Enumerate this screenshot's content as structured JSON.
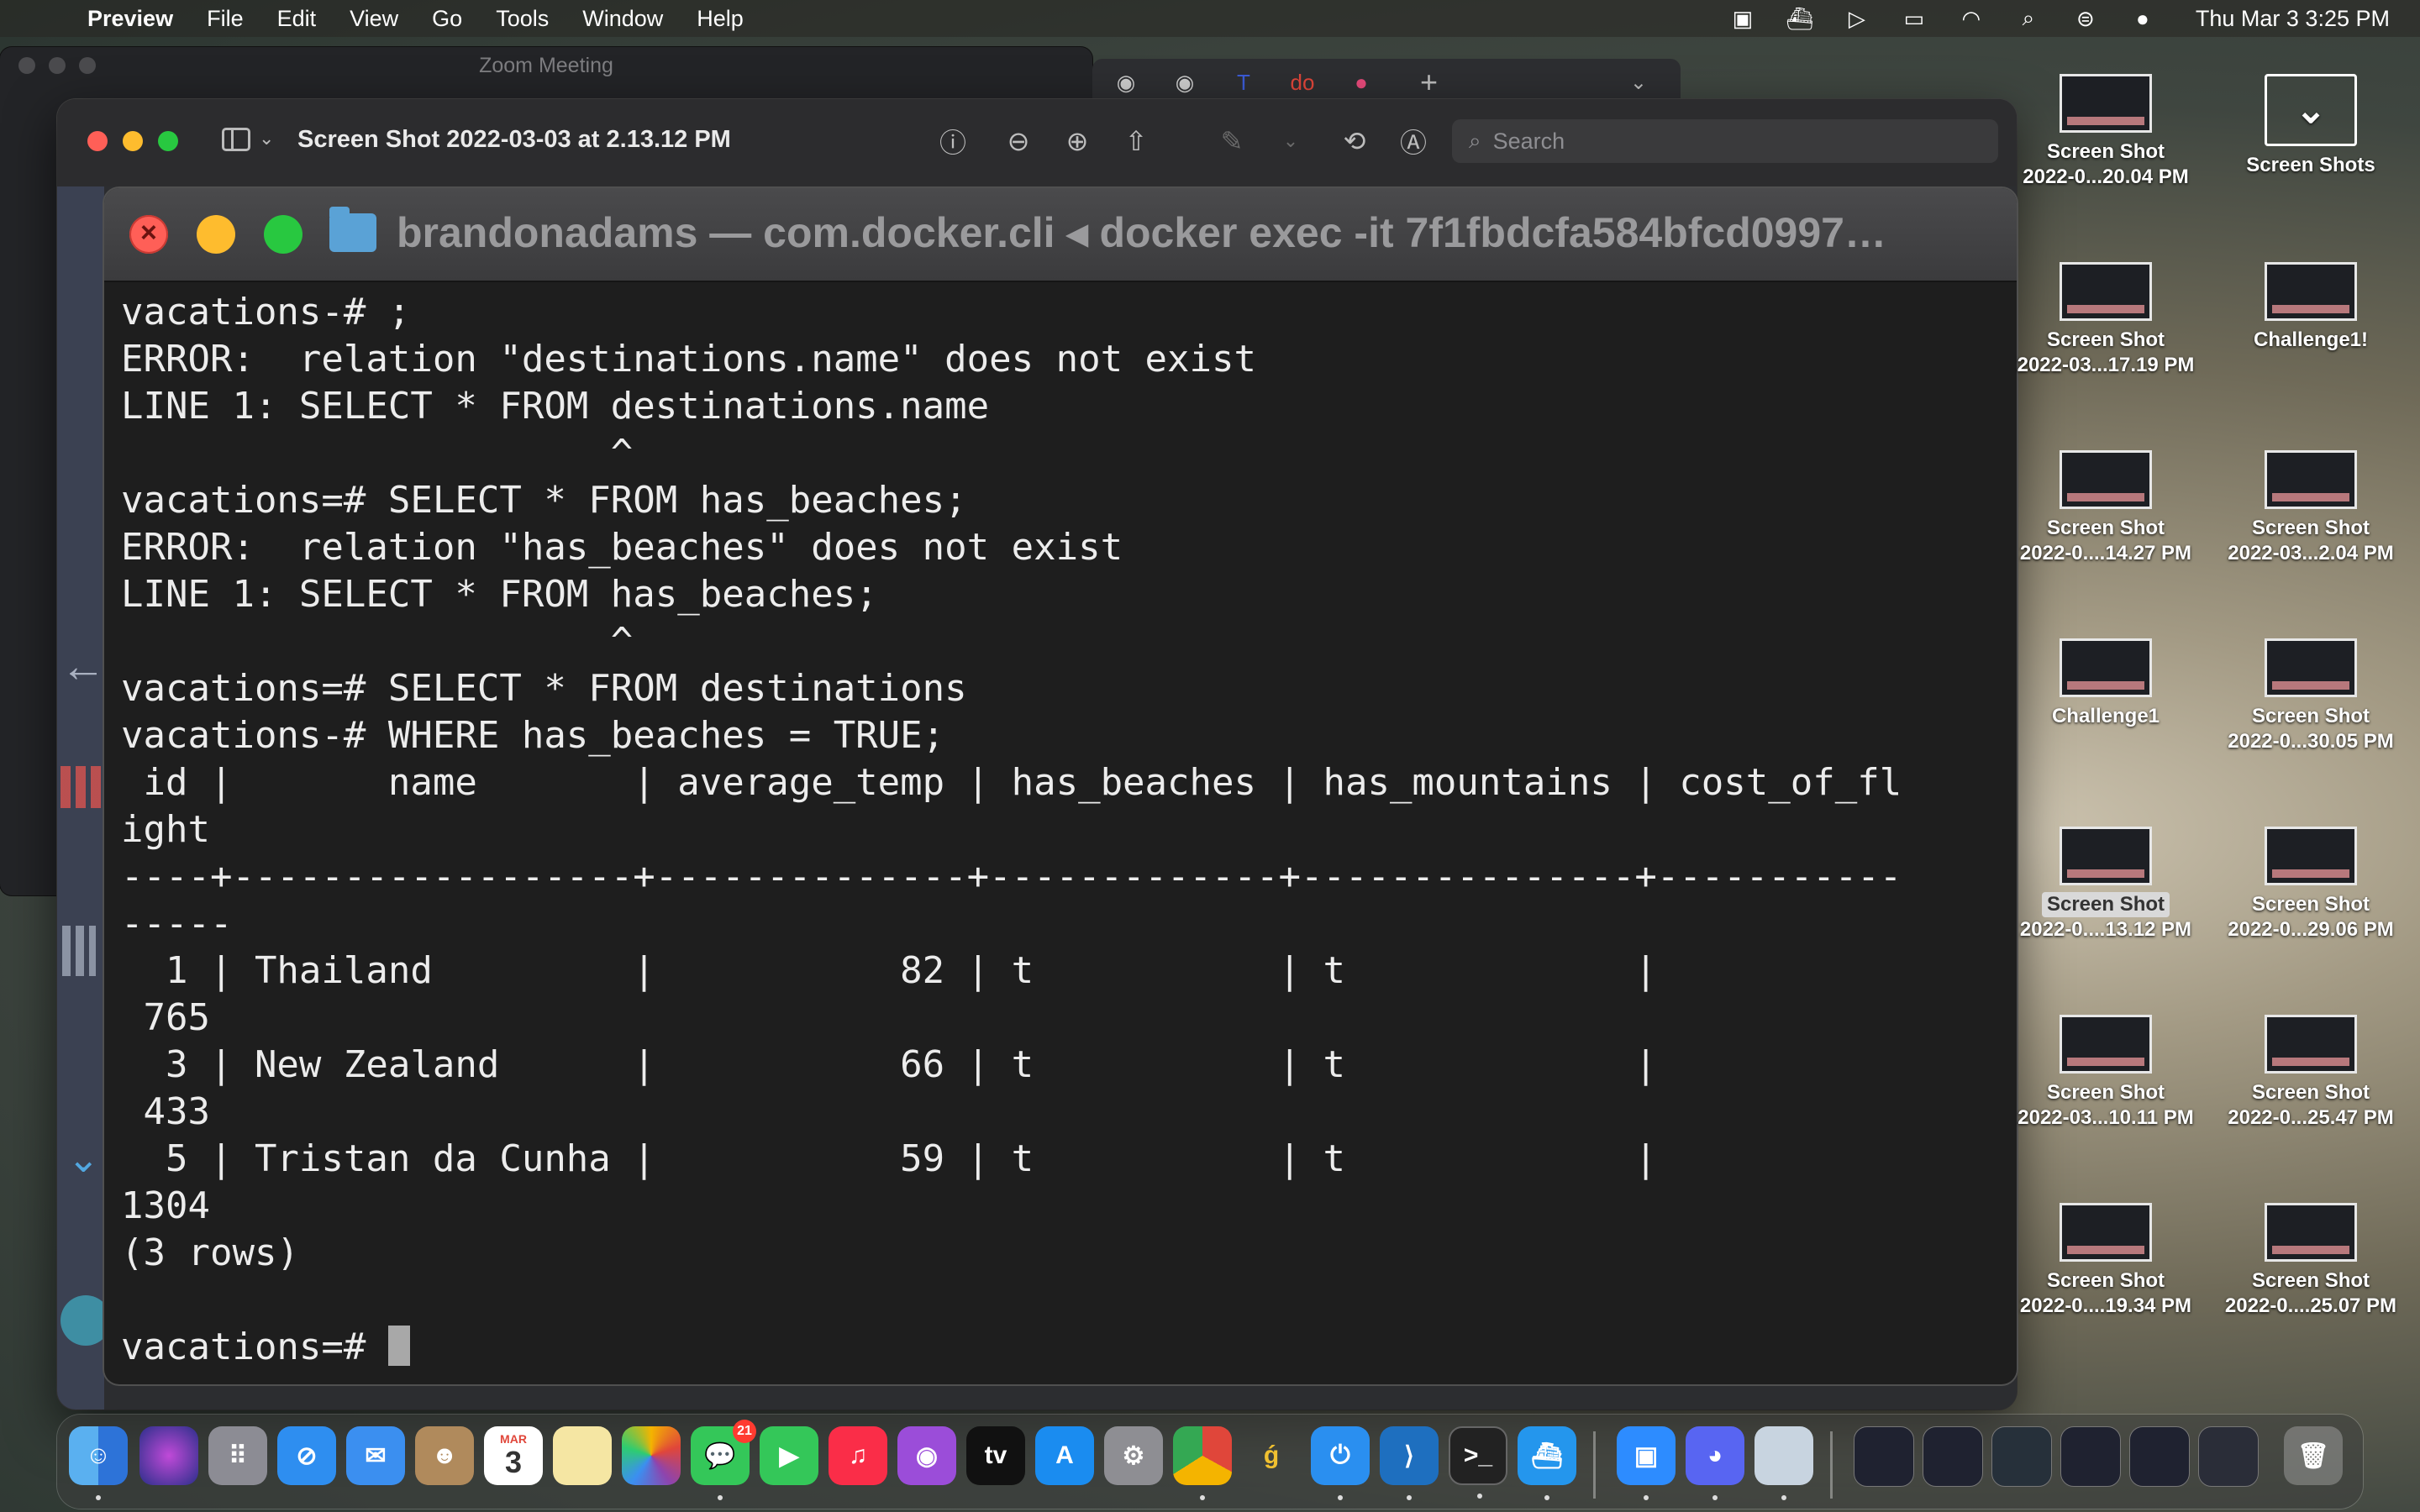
{
  "menubar": {
    "app": "Preview",
    "items": [
      "File",
      "Edit",
      "View",
      "Go",
      "Tools",
      "Window",
      "Help"
    ],
    "clock": "Thu Mar 3  3:25 PM"
  },
  "zoom": {
    "title": "Zoom Meeting"
  },
  "preview": {
    "title": "Screen Shot 2022-03-03 at 2.13.12 PM",
    "search_placeholder": "Search"
  },
  "terminal": {
    "title": "brandonadams — com.docker.cli ◂ docker exec -it 7f1fbdcfa584bfcd0997…",
    "lines": [
      "vacations-# ;",
      "ERROR:  relation \"destinations.name\" does not exist",
      "LINE 1: SELECT * FROM destinations.name",
      "                      ^",
      "vacations=# SELECT * FROM has_beaches;",
      "ERROR:  relation \"has_beaches\" does not exist",
      "LINE 1: SELECT * FROM has_beaches;",
      "                      ^",
      "vacations=# SELECT * FROM destinations",
      "vacations-# WHERE has_beaches = TRUE;",
      " id |       name       | average_temp | has_beaches | has_mountains | cost_of_fl",
      "ight",
      "----+------------------+--------------+-------------+---------------+-----------",
      "-----",
      "  1 | Thailand         |           82 | t           | t             |",
      " 765",
      "  3 | New Zealand      |           66 | t           | t             |",
      " 433",
      "  5 | Tristan da Cunha |           59 | t           | t             |",
      "1304",
      "(3 rows)",
      "",
      "vacations=# "
    ]
  },
  "desktop": {
    "icons": [
      {
        "label": "Screen Shot",
        "sub": "2022-0...20.04 PM"
      },
      {
        "label": "Screen Shots",
        "sub": ""
      },
      {
        "label": "Screen Shot",
        "sub": "2022-03...17.19 PM"
      },
      {
        "label": "Challenge1!",
        "sub": ""
      },
      {
        "label": "Screen Shot",
        "sub": "2022-0....14.27 PM"
      },
      {
        "label": "Screen Shot",
        "sub": "2022-03...2.04 PM"
      },
      {
        "label": "Challenge1",
        "sub": ""
      },
      {
        "label": "Screen Shot",
        "sub": "2022-0...30.05 PM"
      },
      {
        "label": "Screen Shot",
        "sub": "2022-0....13.12 PM"
      },
      {
        "label": "Screen Shot",
        "sub": "2022-0...29.06 PM"
      },
      {
        "label": "Screen Shot",
        "sub": "2022-03...10.11 PM"
      },
      {
        "label": "Screen Shot",
        "sub": "2022-0...25.47 PM"
      },
      {
        "label": "Screen Shot",
        "sub": "2022-0....19.34 PM"
      },
      {
        "label": "Screen Shot",
        "sub": "2022-0....25.07 PM"
      }
    ]
  },
  "dock": {
    "calendar_month": "MAR",
    "calendar_day": "3",
    "messages_badge": "21",
    "tv_label": "tv"
  }
}
